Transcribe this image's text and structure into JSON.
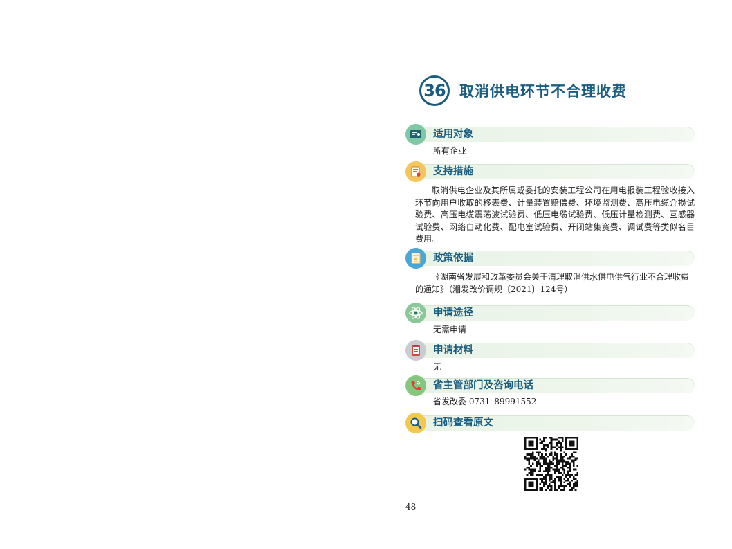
{
  "title": {
    "number": "36",
    "text": "取消供电环节不合理收费"
  },
  "sections": {
    "target": {
      "title": "适用对象",
      "body": "所有企业",
      "icon": "id-card-icon",
      "color": "#7ec8a6"
    },
    "measures": {
      "title": "支持措施",
      "body": "取消供电企业及其所属或委托的安装工程公司在用电报装工程验收接入环节向用户收取的移表费、计量装置赔偿费、环境监测费、高压电缆介损试验费、高压电缆震荡波试验费、低压电缆试验费、低压计量检测费、互感器试验费、网络自动化费、配电室试验费、开闭站集资费、调试费等类似名目费用。",
      "icon": "document-seal-icon",
      "color": "#f3c55a"
    },
    "basis": {
      "title": "政策依据",
      "body": "《湖南省发展和改革委员会关于清理取消供水供电供气行业不合理收费的通知》（湘发改价调规〔2021〕124号）",
      "icon": "certificate-icon",
      "color": "#49a6d8"
    },
    "channel": {
      "title": "申请途径",
      "body": "无需申请",
      "icon": "atom-icon",
      "color": "#8cc79a"
    },
    "materials": {
      "title": "申请材料",
      "body": "无",
      "icon": "clipboard-icon",
      "color": "#c9ccd1"
    },
    "contact": {
      "title": "省主管部门及咨询电话",
      "body": "省发改委 0731–89991552",
      "icon": "phone-icon",
      "color": "#86c77f"
    },
    "scan": {
      "title": "扫码查看原文",
      "icon": "magnifier-icon",
      "color": "#f2c94c"
    }
  },
  "page_number": "48"
}
